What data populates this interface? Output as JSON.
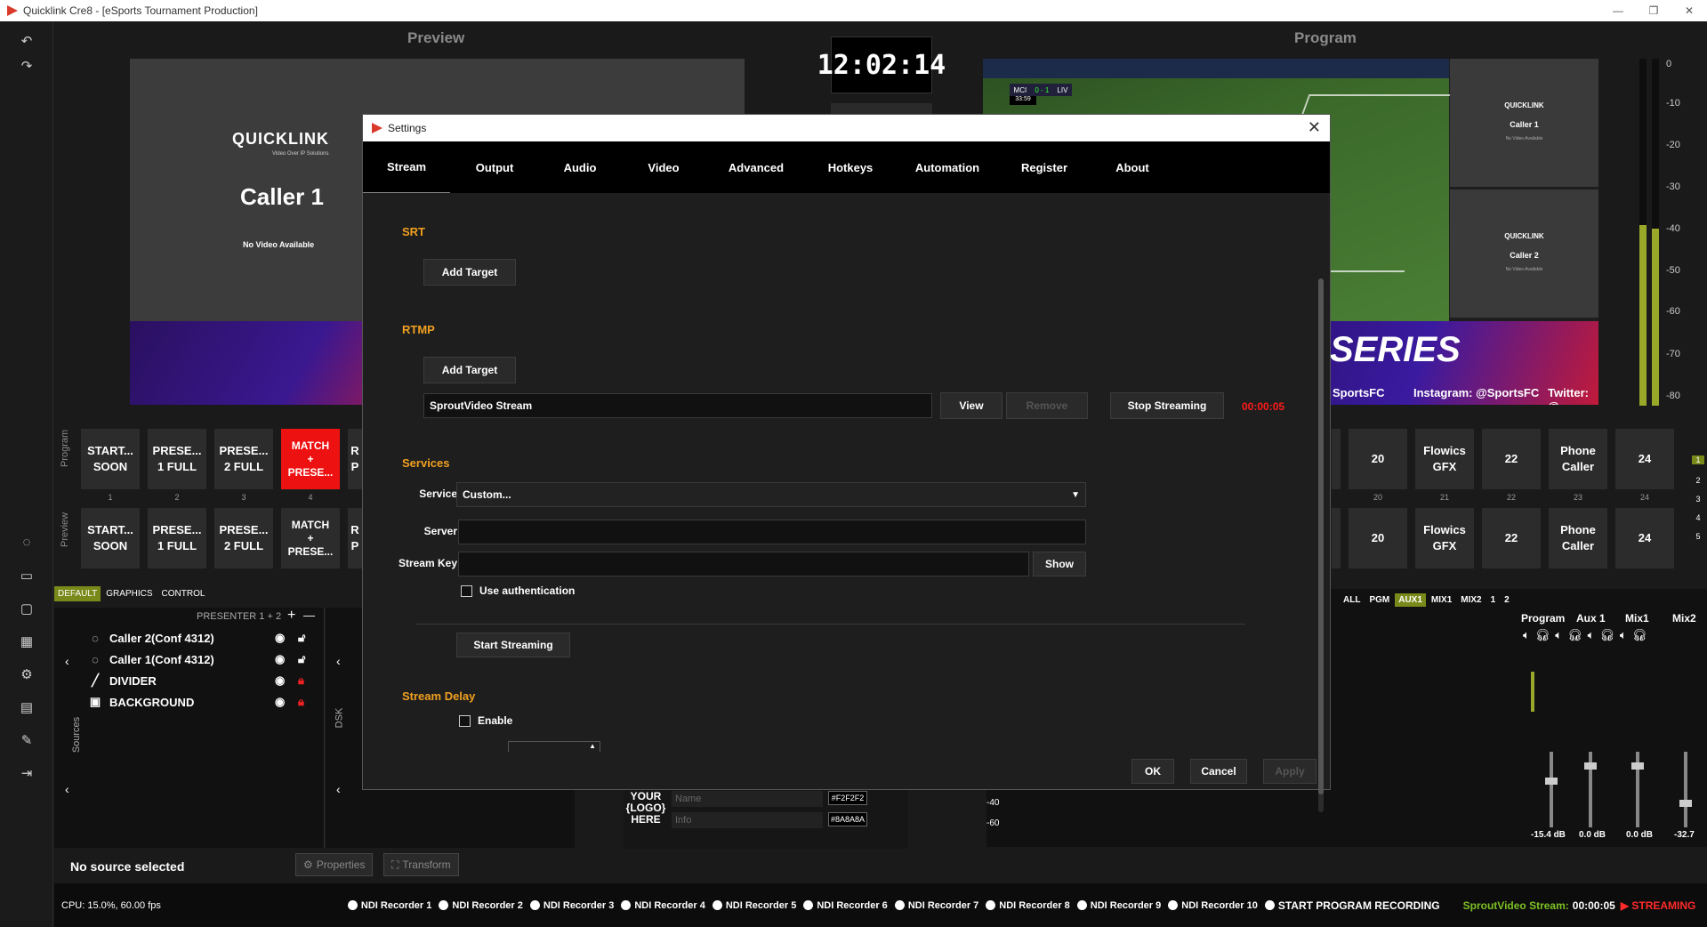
{
  "window": {
    "title": "Quicklink Cre8 - [eSports Tournament Production]",
    "min": "—",
    "restore": "❐",
    "close": "✕"
  },
  "headers": {
    "preview": "Preview",
    "program": "Program"
  },
  "clock": "12:02:14",
  "preview_card": {
    "logo": "QUICKLINK",
    "tagline": "Video Over IP Solutions",
    "title": "Caller 1",
    "status": "No Video Available"
  },
  "program_view": {
    "score_home": "MCI",
    "score": "0 - 1",
    "score_away": "LIV",
    "match_time": "33:59",
    "side_cards": [
      {
        "logo": "QUICKLINK",
        "name": "Caller 1",
        "sub": "No Video Available"
      },
      {
        "logo": "QUICKLINK",
        "name": "Caller 2",
        "sub": "No Video Available"
      }
    ],
    "banner_text": "SERIES",
    "social_1": "SportsFC",
    "social_2": "Instagram: @SportsFC",
    "social_3": "Twitter: @"
  },
  "vu_ticks": [
    "0",
    "-10",
    "-20",
    "-30",
    "-40",
    "-50",
    "-60",
    "-70",
    "-80"
  ],
  "vu_levels": {
    "left": 0.52,
    "right": 0.51
  },
  "program_row_label": "Program",
  "preview_row_label": "Preview",
  "scene_buttons_left": [
    {
      "label": "START...\nSOON",
      "num": "1"
    },
    {
      "label": "PRESE...\n1 FULL",
      "num": "2"
    },
    {
      "label": "PRESE...\n2 FULL",
      "num": "3"
    },
    {
      "label": "MATCH\n+\nPRESE...",
      "num": "4"
    },
    {
      "label": "R\nP",
      "num": ""
    }
  ],
  "scene_buttons_right": [
    {
      "label": "",
      "num": ""
    },
    {
      "label": "20",
      "num": "20"
    },
    {
      "label": "Flowics\nGFX",
      "num": "21"
    },
    {
      "label": "22",
      "num": "22"
    },
    {
      "label": "Phone\nCaller",
      "num": "23"
    },
    {
      "label": "24",
      "num": "24"
    }
  ],
  "side_page_nums": [
    "1",
    "2",
    "3",
    "4",
    "5"
  ],
  "small_tabs": [
    "DEFAULT",
    "GRAPHICS",
    "CONTROL"
  ],
  "sources": {
    "header": "PRESENTER 1 + 2",
    "add": "+",
    "remove": "—",
    "vertical_label": "Sources",
    "items": [
      {
        "icon": "◌",
        "name": "Caller 2(Conf 4312)",
        "locked": false
      },
      {
        "icon": "◌",
        "name": "Caller 1(Conf 4312)",
        "locked": false
      },
      {
        "icon": "╱",
        "name": "DIVIDER",
        "locked": true
      },
      {
        "icon": "▣",
        "name": "BACKGROUND",
        "locked": true
      }
    ]
  },
  "dsk_label": "DSK",
  "overlay": {
    "logo_l1": "YOUR",
    "logo_l2": "{LOGO}",
    "logo_l3": "HERE",
    "name_ph": "Name",
    "info_ph": "Info",
    "color1": "#F2F2F2",
    "color2": "#8A8A8A"
  },
  "mixer": {
    "tabs": [
      "ALL",
      "PGM",
      "AUX1",
      "MIX1",
      "MIX2",
      "1",
      "2"
    ],
    "active_tab": "AUX1",
    "channels": [
      {
        "name": "Program",
        "db": "-15.4 dB",
        "level": 0.62
      },
      {
        "name": "Aux 1",
        "db": "0.0 dB",
        "level": 0.85
      },
      {
        "name": "Mix1",
        "db": "0.0 dB",
        "level": 0.85
      },
      {
        "name": "Mix2",
        "db": "-32.7",
        "level": 0.3
      }
    ],
    "scale": [
      "-40",
      "-60"
    ]
  },
  "status": {
    "no_source": "No source selected",
    "properties": "Properties",
    "transform": "Transform"
  },
  "footer": {
    "cpu": "CPU: 15.0%, 60.00 fps",
    "recorders": [
      "NDI Recorder 1",
      "NDI Recorder 2",
      "NDI Recorder 3",
      "NDI Recorder 4",
      "NDI Recorder 5",
      "NDI Recorder 6",
      "NDI Recorder 7",
      "NDI Recorder 8",
      "NDI Recorder 9",
      "NDI Recorder 10"
    ],
    "program_rec": "START PROGRAM RECORDING",
    "stream_label": "SproutVideo Stream:",
    "stream_time": "00:00:05",
    "streaming": "STREAMING"
  },
  "settings": {
    "title": "Settings",
    "close": "✕",
    "tabs": [
      "Stream",
      "Output",
      "Audio",
      "Video",
      "Advanced",
      "Hotkeys",
      "Automation",
      "Register",
      "About"
    ],
    "active_tab": "Stream",
    "srt": {
      "heading": "SRT",
      "add_target": "Add Target"
    },
    "rtmp": {
      "heading": "RTMP",
      "add_target": "Add Target",
      "target_name": "SproutVideo Stream",
      "view": "View",
      "remove": "Remove",
      "stop": "Stop Streaming",
      "elapsed": "00:00:05"
    },
    "services": {
      "heading": "Services",
      "service_label": "Service",
      "service_value": "Custom...",
      "server_label": "Server",
      "server_value": "",
      "key_label": "Stream Key",
      "key_value": "",
      "show": "Show",
      "use_auth": "Use authentication",
      "start": "Start Streaming"
    },
    "delay": {
      "heading": "Stream Delay",
      "enable": "Enable"
    },
    "footer": {
      "ok": "OK",
      "cancel": "Cancel",
      "apply": "Apply"
    }
  },
  "colors": {
    "accent": "#f0a020",
    "active_green": "#7a8a1a",
    "live_red": "#ee1111"
  }
}
